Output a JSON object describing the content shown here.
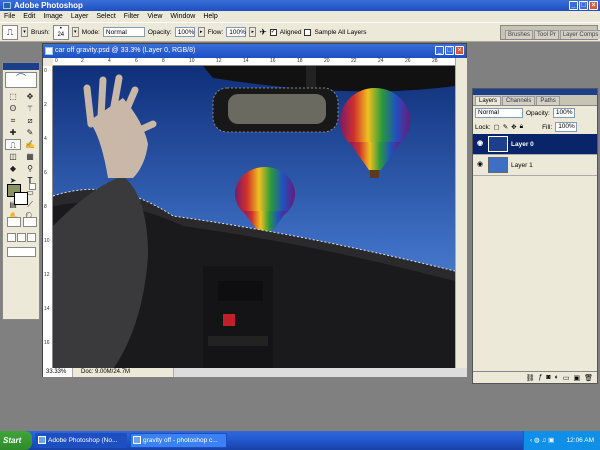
{
  "app": {
    "title": "Adobe Photoshop"
  },
  "menu": [
    "File",
    "Edit",
    "Image",
    "Layer",
    "Select",
    "Filter",
    "View",
    "Window",
    "Help"
  ],
  "options": {
    "brush_label": "Brush:",
    "brush_size": "24",
    "mode_label": "Mode:",
    "mode_value": "Normal",
    "opacity_label": "Opacity:",
    "opacity_value": "100%",
    "flow_label": "Flow:",
    "flow_value": "100%",
    "aligned_label": "Aligned",
    "sample_all_label": "Sample All Layers",
    "well_tabs": [
      "Brushes",
      "Tool Pr",
      "Layer Comps"
    ]
  },
  "document": {
    "title": "car off gravity.psd @ 33.3% (Layer 0, RGB/8)",
    "zoom": "33.33%",
    "doc_info": "Doc: 9.00M/24.7M",
    "ruler_h": [
      "0",
      "2",
      "4",
      "6",
      "8",
      "10",
      "12",
      "14",
      "16",
      "18",
      "20",
      "22",
      "24",
      "26",
      "28"
    ],
    "ruler_v": [
      "0",
      "2",
      "4",
      "6",
      "8",
      "10",
      "12",
      "14",
      "16"
    ]
  },
  "layers_panel": {
    "tabs": [
      "Layers",
      "Channels",
      "Paths"
    ],
    "blend_mode": "Normal",
    "opacity_label": "Opacity:",
    "opacity_value": "100%",
    "lock_label": "Lock:",
    "fill_label": "Fill:",
    "fill_value": "100%",
    "layers": [
      {
        "name": "Layer 0",
        "active": true
      },
      {
        "name": "Layer 1",
        "active": false
      }
    ]
  },
  "taskbar": {
    "start": "Start",
    "items": [
      "Adobe Photoshop (No...",
      "gravity off - photoshop c..."
    ],
    "clock": "12:06 AM"
  },
  "colors": {
    "foreground": "#8a9460",
    "background": "#ffffff",
    "selection": "#0a246a"
  }
}
